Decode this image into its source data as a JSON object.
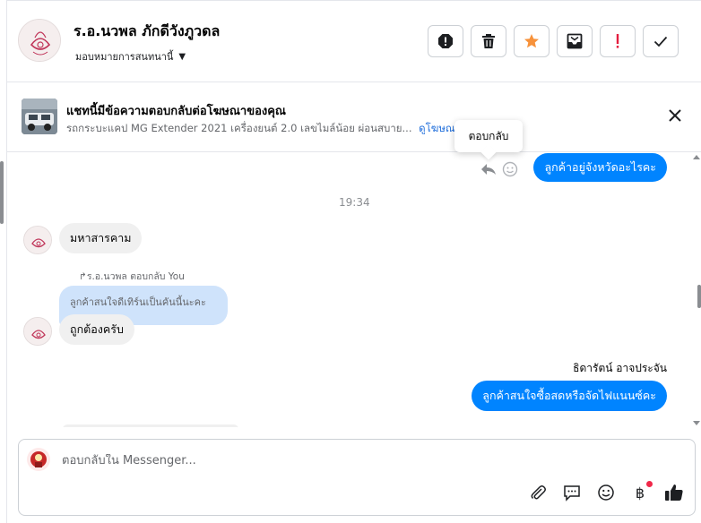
{
  "header": {
    "user_name": "ร.อ.นวพล ภักดีวังภูวดล",
    "assign_label": "มอบหมายการสนทนานี้",
    "actions": [
      "spam-icon",
      "trash-icon",
      "star-icon",
      "mark-unread-icon",
      "follow-up-icon",
      "done-icon"
    ],
    "accent_orange": "#f7923b",
    "alert_red": "#e41e3f"
  },
  "ad": {
    "title": "แชทนี้มีข้อความตอบกลับต่อโฆษณาของคุณ",
    "description": "รถกระบะแคป MG Extender 2021 เครื่องยนต์ 2.0 เลขไมล์น้อย ผ่อนสบาย...",
    "link": "ดูโฆษณา"
  },
  "tooltip": {
    "text": "ตอบกลับ"
  },
  "messages": {
    "out_1": "ลูกค้าอยู่จังหวัดอะไรคะ",
    "timestamp": "19:34",
    "in_1": "มหาสารคาม",
    "reply_meta": "ร.อ.นวพล ตอบกลับ You",
    "reply_quote": "ลูกค้าสนใจดีเทิร์นเป็นคันนี้นะคะ",
    "in_2": "ถูกต้องครับ",
    "sender": "ธิดารัตน์ อาจประจัน",
    "out_2": "ลูกค้าสนใจซื้อสดหรือจัดไฟแนนซ์คะ",
    "bubble_color": "#0084ff"
  },
  "composer": {
    "placeholder": "ตอบกลับใน Messenger...",
    "baht": "฿",
    "tools": [
      "attach-icon",
      "saved-reply-icon",
      "emoji-icon",
      "payment-icon",
      "like-icon"
    ]
  }
}
